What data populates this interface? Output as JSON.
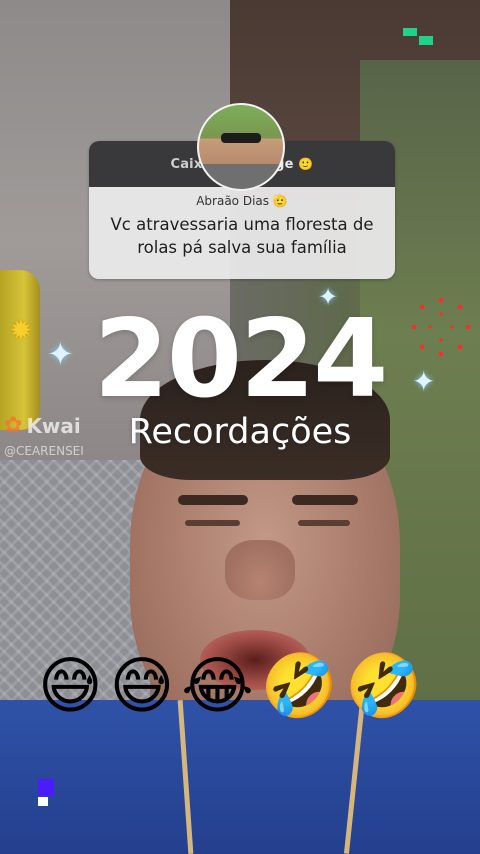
{
  "question_card": {
    "header_left": "Caixi",
    "header_right": "ge",
    "header_emoji": "🙂",
    "author": "Abraão Dias 🫡",
    "text": "Vc atravessaria uma floresta de rolas  pá salva sua família"
  },
  "headline": {
    "year": "2024",
    "subtitle": "Recordações"
  },
  "watermark": {
    "brand": "Kwai",
    "handle": "@CEARENSEI"
  },
  "emoji_row": [
    "😅",
    "😅",
    "😂",
    "🤣",
    "🤣"
  ],
  "decorations": {
    "sparkle_icon": "four-point-star",
    "sun_icon": "sun-flower",
    "burst_icon": "red-dot-firework",
    "accent_green": "#1ed38a",
    "accent_blue": "#4b1cff",
    "shirt_color": "#2f52a8"
  }
}
